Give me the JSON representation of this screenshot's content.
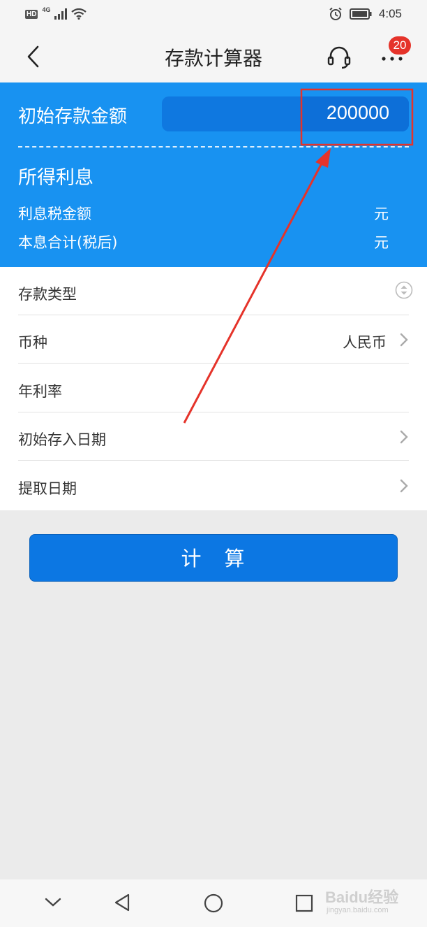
{
  "status_bar": {
    "hd": "HD",
    "network": "4G",
    "time": "4:05"
  },
  "header": {
    "title": "存款计算器",
    "badge_count": "20"
  },
  "summary": {
    "amount_label": "初始存款金额",
    "amount_value": "200000",
    "interest_title": "所得利息",
    "tax_label": "利息税金额",
    "tax_unit": "元",
    "total_label": "本息合计(税后)",
    "total_unit": "元"
  },
  "form": {
    "deposit_type_label": "存款类型",
    "currency_label": "币种",
    "currency_value": "人民币",
    "rate_label": "年利率",
    "start_date_label": "初始存入日期",
    "end_date_label": "提取日期"
  },
  "calc_button": "计　算",
  "watermark": {
    "brand": "Baidu经验",
    "url": "jingyan.baidu.com"
  },
  "colors": {
    "primary_blue": "#1892f1",
    "button_blue": "#0c77e3",
    "annotation_red": "#e5332a"
  },
  "icons": [
    "back-arrow-icon",
    "headset-icon",
    "more-icon",
    "chevron-right-icon",
    "up-down-icon",
    "nav-down-icon",
    "nav-back-icon",
    "nav-home-icon",
    "nav-recent-icon"
  ]
}
